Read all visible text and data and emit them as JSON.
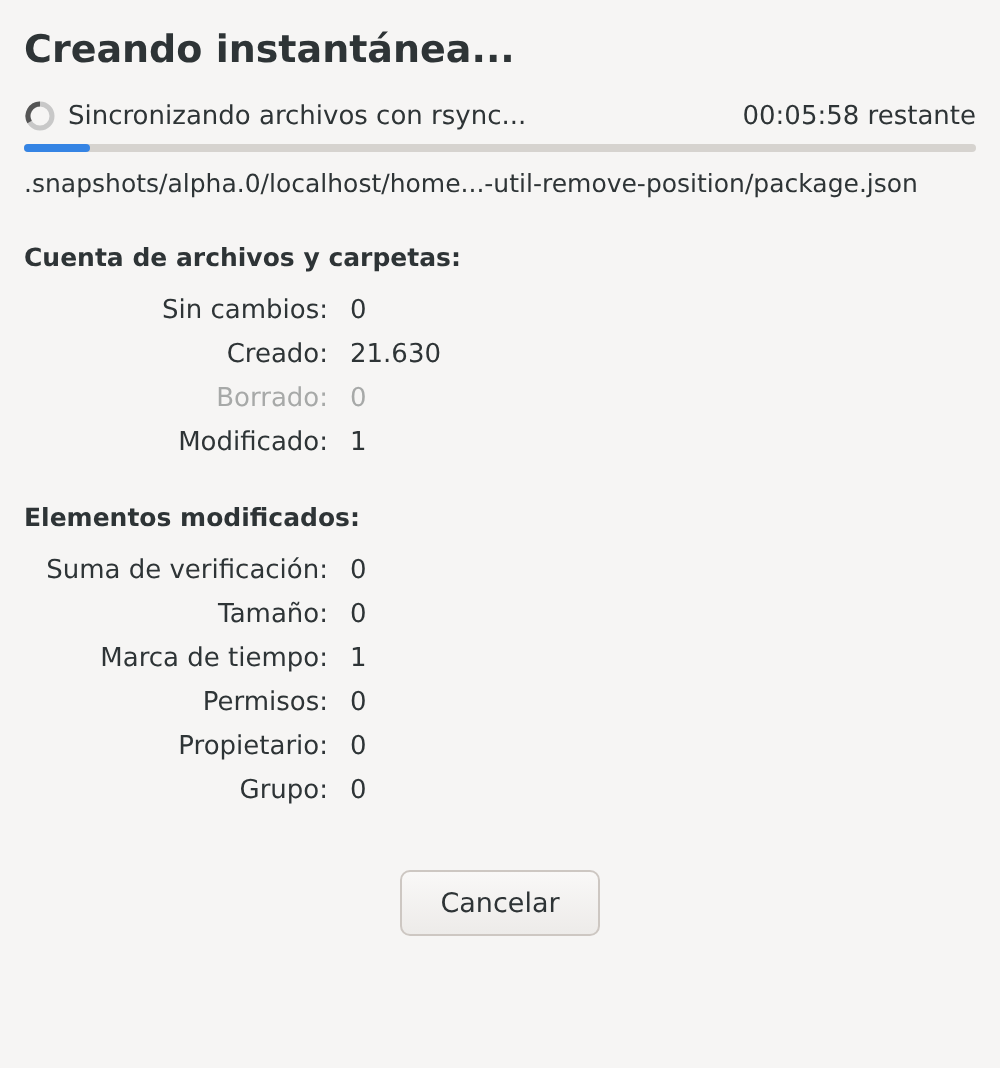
{
  "title": "Creando instantánea...",
  "progress": {
    "status": "Sincronizando archivos con rsync...",
    "remaining": "00:05:58 restante",
    "level": 0.07
  },
  "current_file": ".snapshots/alpha.0/localhost/home...-util-remove-position/package.json",
  "sections": [
    {
      "heading": "Cuenta de archivos y carpetas:",
      "rows": [
        {
          "label": "Sin cambios:",
          "value": "0",
          "disabled": false
        },
        {
          "label": "Creado:",
          "value": "21.630",
          "disabled": false
        },
        {
          "label": "Borrado:",
          "value": "0",
          "disabled": true
        },
        {
          "label": "Modificado:",
          "value": "1",
          "disabled": false
        }
      ]
    },
    {
      "heading": "Elementos modificados:",
      "rows": [
        {
          "label": "Suma de verificación:",
          "value": "0",
          "disabled": false
        },
        {
          "label": "Tamaño:",
          "value": "0",
          "disabled": false
        },
        {
          "label": "Marca de tiempo:",
          "value": "1",
          "disabled": false
        },
        {
          "label": "Permisos:",
          "value": "0",
          "disabled": false
        },
        {
          "label": "Propietario:",
          "value": "0",
          "disabled": false
        },
        {
          "label": "Grupo:",
          "value": "0",
          "disabled": false
        }
      ]
    }
  ],
  "buttons": [
    "Cancelar"
  ]
}
